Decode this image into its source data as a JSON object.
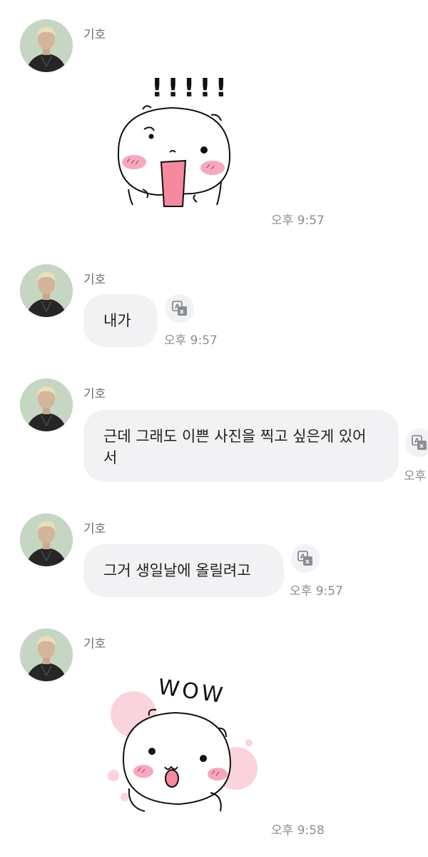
{
  "chat": {
    "messages": [
      {
        "sender": "기호",
        "type": "sticker",
        "sticker_icon": "surprised-hamster-sticker",
        "sticker_text": "!!!!!",
        "time": "오후 9:57"
      },
      {
        "sender": "기호",
        "type": "text",
        "text": "내가",
        "time": "오후 9:57"
      },
      {
        "sender": "기호",
        "type": "text",
        "text": "근데 그래도 이쁜 사진을 찍고 싶은게 있어",
        "text_line2": "서",
        "time": "오후"
      },
      {
        "sender": "기호",
        "type": "text",
        "text": "그거 생일날에 올릴려고",
        "time": "오후 9:57"
      },
      {
        "sender": "기호",
        "type": "sticker",
        "sticker_icon": "wow-hamster-sticker",
        "sticker_text": "WOW",
        "time": "오후 9:58"
      }
    ],
    "icons": {
      "translate": "translate-icon",
      "avatar": "profile-photo"
    },
    "colors": {
      "bubble": "#f2f2f5",
      "blush": "#f7a8bc",
      "tongue": "#f5899f",
      "time": "#8e8e93"
    }
  }
}
